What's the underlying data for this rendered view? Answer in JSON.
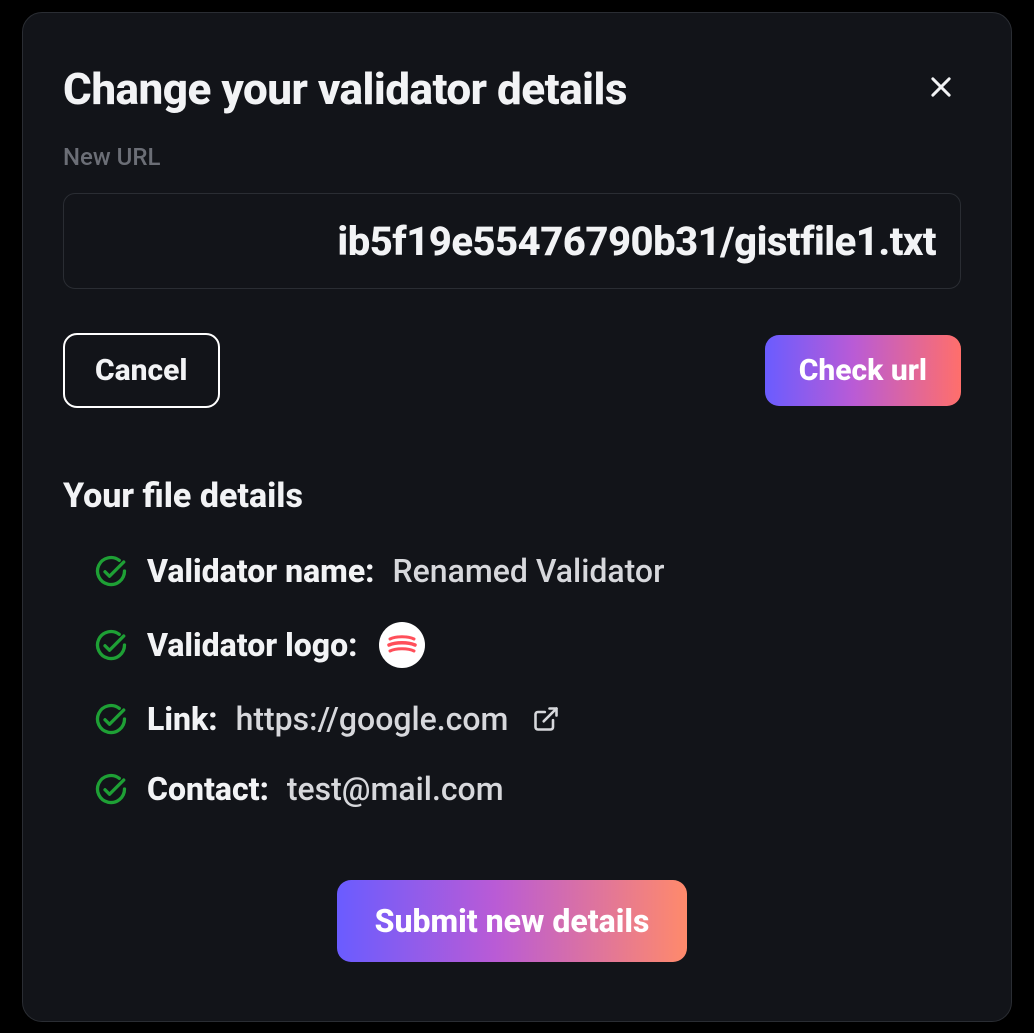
{
  "modal": {
    "title": "Change your validator details",
    "url_label": "New URL",
    "url_value": "ib5f19e55476790b31/gistfile1.txt",
    "cancel_label": "Cancel",
    "check_label": "Check url",
    "section_title": "Your file details",
    "details": {
      "name_label": "Validator name:",
      "name_value": "Renamed Validator",
      "logo_label": "Validator logo:",
      "link_label": "Link:",
      "link_value": "https://google.com",
      "contact_label": "Contact:",
      "contact_value": "test@mail.com"
    },
    "submit_label": "Submit new details"
  },
  "icons": {
    "close": "close-icon",
    "check": "check-circle-icon",
    "external": "external-link-icon",
    "logo": "sphere-logo"
  },
  "colors": {
    "background": "#121419",
    "border": "#2a2d33",
    "text": "#f2f3f5",
    "muted": "#6b6e76",
    "success": "#1ea035",
    "gradient_start": "#6a5cff",
    "gradient_mid": "#b95bd6",
    "gradient_end": "#ff6f6b"
  }
}
